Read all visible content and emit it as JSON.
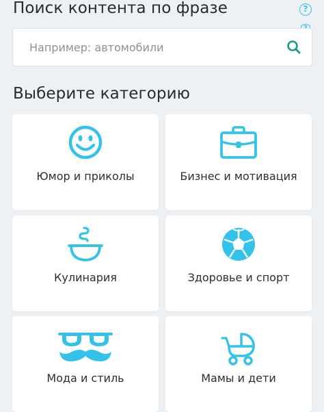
{
  "search": {
    "heading": "Поиск контента по фразе",
    "placeholder": "Например: автомобили",
    "value": ""
  },
  "categories": {
    "heading": "Выберите категорию",
    "items": [
      {
        "label": "Юмор и приколы",
        "icon": "smiley-icon"
      },
      {
        "label": "Бизнес и мотивация",
        "icon": "briefcase-icon"
      },
      {
        "label": "Кулинария",
        "icon": "steaming-bowl-icon"
      },
      {
        "label": "Здоровье и спорт",
        "icon": "soccer-ball-icon"
      },
      {
        "label": "Мода и стиль",
        "icon": "glasses-mustache-icon"
      },
      {
        "label": "Мамы и дети",
        "icon": "baby-stroller-icon"
      }
    ]
  },
  "colors": {
    "accent": "#33c3ea",
    "background": "#eef1f4",
    "card": "#ffffff",
    "search_icon": "#1a9a8a"
  }
}
